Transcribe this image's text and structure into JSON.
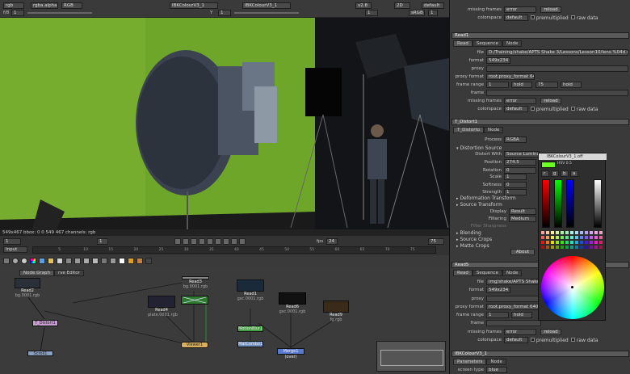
{
  "viewer_top": {
    "channels": "rgb",
    "alpha": "rgba.alpha",
    "mode": "RGB",
    "input_a": "IBKColourV3_1",
    "input_b": "IBKColourV3_1",
    "zoom": "1",
    "gain_label": "f/8",
    "gain_value": "1",
    "gamma_label": "Y",
    "gamma_value": "1",
    "version": "v2.8",
    "view": "2D",
    "lut": "default",
    "proxy": "sRGB",
    "frame": "1"
  },
  "viewer_status": "549x467  bbox: 0 0 549 467  channels: rgb",
  "timeline": {
    "start": "1",
    "current": "1",
    "fps_label": "fps",
    "fps": "24",
    "end": "75",
    "input_label": "Input",
    "ticks": [
      "5",
      "10",
      "15",
      "20",
      "25",
      "30",
      "35",
      "40",
      "45",
      "50",
      "55",
      "60",
      "65",
      "70",
      "75"
    ]
  },
  "node_graph": {
    "tabs": [
      "Node Graph",
      "rve Editor"
    ],
    "nodes": [
      {
        "label": "Read2",
        "sub": "bg.0001.rgb"
      },
      {
        "label": "Read3",
        "sub": "bg.0001.rgb"
      },
      {
        "label": "Read4",
        "sub": "plate.0001.rgb"
      },
      {
        "label": "Read1",
        "sub": "gsc.0001.rgb"
      },
      {
        "label": "Read6",
        "sub": "gsc.0001.rgb"
      },
      {
        "label": "Read9",
        "sub": "fg.rgb"
      },
      {
        "label": "Transform1",
        "sub": ""
      },
      {
        "label": "Viewer1",
        "sub": ""
      },
      {
        "label": "T_Distort1",
        "sub": ""
      },
      {
        "label": "MotionBlur1",
        "sub": ""
      },
      {
        "label": "MatCombo1",
        "sub": ""
      },
      {
        "label": "Merge1 (over)",
        "sub": ""
      },
      {
        "label": "Scroll1",
        "sub": ""
      }
    ]
  },
  "properties": {
    "top": {
      "missing_frames_label": "missing frames",
      "missing_frames": "error",
      "reload": "reload",
      "colorspace_label": "colorspace",
      "colorspace": "default",
      "premult": "premultiplied",
      "raw": "raw data"
    },
    "read1": {
      "title": "Read1",
      "tabs": [
        "Read",
        "Sequence",
        "Node"
      ],
      "file_label": "file",
      "file": "D:/Training/shake/APTS Shake 3/Lessons/Lesson10/lens.%04d.rgb",
      "format_label": "format",
      "format": "549x234",
      "proxy_label": "proxy",
      "proxy_format_label": "proxy format",
      "proxy_format": "root.proxy_format 640x480",
      "frame_range_label": "frame range",
      "frame_start": "1",
      "hold1": "hold",
      "frame_end": "75",
      "hold2": "hold",
      "frame_label": "frame",
      "missing_frames_label": "missing frames",
      "missing_frames": "error",
      "reload": "reload",
      "colorspace_label": "colorspace",
      "colorspace": "default",
      "premult": "premultiplied",
      "raw": "raw data"
    },
    "distort": {
      "title": "T_Distort1",
      "tabs": [
        "T_Distorto",
        "Node"
      ],
      "process_label": "Process",
      "process": "RGBA",
      "distortion_source": "Distortion Source",
      "distort_with_label": "Distort With",
      "distort_with": "Source Luminance",
      "position_label": "Position",
      "position": "274.5",
      "rotation_label": "Rotation",
      "rotation": "0",
      "scale_label": "Scale",
      "scale": "1",
      "softness_label": "Softness",
      "softness": "0",
      "strength_label": "Strength",
      "strength": "1",
      "deformation": "Deformation Transform",
      "source_transform": "Source Transform",
      "display_label": "Display",
      "display": "Result",
      "filtering_label": "Filtering",
      "filtering": "Medium",
      "filter_sharpness": "Filter Sharpness",
      "blending": "Blending",
      "source_crops": "Source Crops",
      "matte_crops": "Matte Crops",
      "about": "About"
    },
    "read5": {
      "title": "Read5",
      "tabs": [
        "Read",
        "Sequence",
        "Node"
      ],
      "file_label": "file",
      "file": "img/shake/APTS Shake 3/Less",
      "format_label": "format",
      "format": "549x234",
      "proxy_label": "proxy",
      "proxy_format_label": "proxy format",
      "proxy_format": "root.proxy_format 640x480",
      "frame_range_label": "frame range",
      "frame_start": "1",
      "hold1": "hold",
      "frame_label": "frame",
      "missing_frames_label": "missing frames",
      "missing_frames": "error",
      "reload": "reload",
      "colorspace_label": "colorspace",
      "colorspace": "default",
      "premult": "premultiplied",
      "raw": "raw data"
    },
    "ibk": {
      "title": "IBKColourV3_1",
      "tabs": [
        "Parameters",
        "Node"
      ],
      "screen_type_label": "screen type",
      "screen_type": "blue"
    }
  },
  "color_picker": {
    "title": "IBKColourV3_1.off",
    "h_label": "HSV",
    "value": "0.5",
    "channels": [
      "r",
      "g",
      "b",
      "a"
    ],
    "accent": "#6cff22"
  }
}
